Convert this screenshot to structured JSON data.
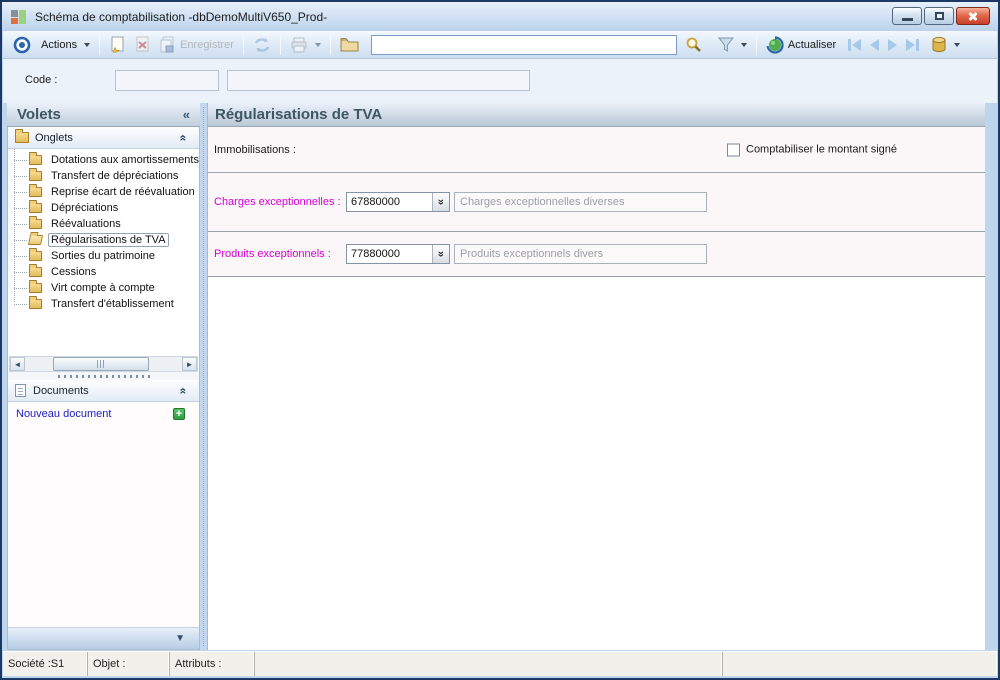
{
  "window": {
    "title": "Schéma de comptabilisation -dbDemoMultiV650_Prod-"
  },
  "toolbar": {
    "actions_label": "Actions",
    "save_label": "Enregistrer",
    "refresh_label": "Actualiser",
    "search_value": ""
  },
  "code_row": {
    "label": "Code :",
    "field1": "",
    "field2": ""
  },
  "sidebar": {
    "title": "Volets",
    "onglets_label": "Onglets",
    "documents_label": "Documents",
    "new_document_label": "Nouveau document",
    "selected_index": 5,
    "tree_items": [
      "Dotations aux amortissements",
      "Transfert de dépréciations",
      "Reprise écart de réévaluation",
      "Dépréciations",
      "Réévaluations",
      "Régularisations de TVA",
      "Sorties du patrimoine",
      "Cessions",
      "Virt compte à compte",
      "Transfert d'établissement"
    ]
  },
  "main": {
    "title": "Régularisations de TVA",
    "immobilisations_label": "Immobilisations :",
    "checkbox_label": "Comptabiliser le montant signé",
    "checkbox_checked": false,
    "rows": [
      {
        "label": "Charges exceptionnelles :",
        "account": "67880000",
        "description": "Charges exceptionnelles diverses"
      },
      {
        "label": "Produits exceptionnels :",
        "account": "77880000",
        "description": "Produits exceptionnels divers"
      }
    ]
  },
  "statusbar": {
    "societe": "Société :S1",
    "objet": "Objet :",
    "attributs": "Attributs :"
  },
  "glyphs": {
    "dropdown": "▼",
    "collapse_left": "«",
    "chevron_up": "«",
    "combo_arrow": "«",
    "scroll_left": "◄",
    "scroll_right": "►",
    "panel_down": "▼",
    "plus": "+"
  },
  "colors": {
    "magenta_label": "#d400d4",
    "link_blue": "#2020bf",
    "green_plus": "#2e9e3e",
    "header_text": "#3f5664",
    "disabled_text": "#9a9a9a",
    "close_button_red": "#c8402a"
  }
}
